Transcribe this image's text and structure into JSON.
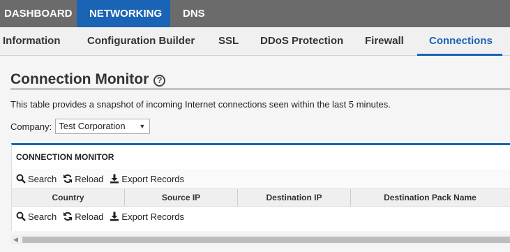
{
  "topnav": {
    "tabs": [
      "DASHBOARD",
      "NETWORKING",
      "DNS"
    ],
    "active": "NETWORKING"
  },
  "subnav": {
    "tabs": [
      "Information",
      "Configuration Builder",
      "SSL",
      "DDoS Protection",
      "Firewall",
      "Connections"
    ],
    "active": "Connections"
  },
  "page": {
    "title": "Connection Monitor",
    "help_icon": "?",
    "description": "This table provides a snapshot of incoming Internet connections seen within the last 5 minutes."
  },
  "company": {
    "label": "Company:",
    "value": "Test Corporation",
    "caret": "▼"
  },
  "panel": {
    "heading": "CONNECTION MONITOR",
    "toolbar": {
      "search": "Search",
      "reload": "Reload",
      "export": "Export Records"
    },
    "columns": [
      "Country",
      "Source IP",
      "Destination IP",
      "Destination Pack Name"
    ]
  },
  "colors": {
    "accent": "#1a64b5",
    "topnav_bg": "#6b6b6b"
  }
}
